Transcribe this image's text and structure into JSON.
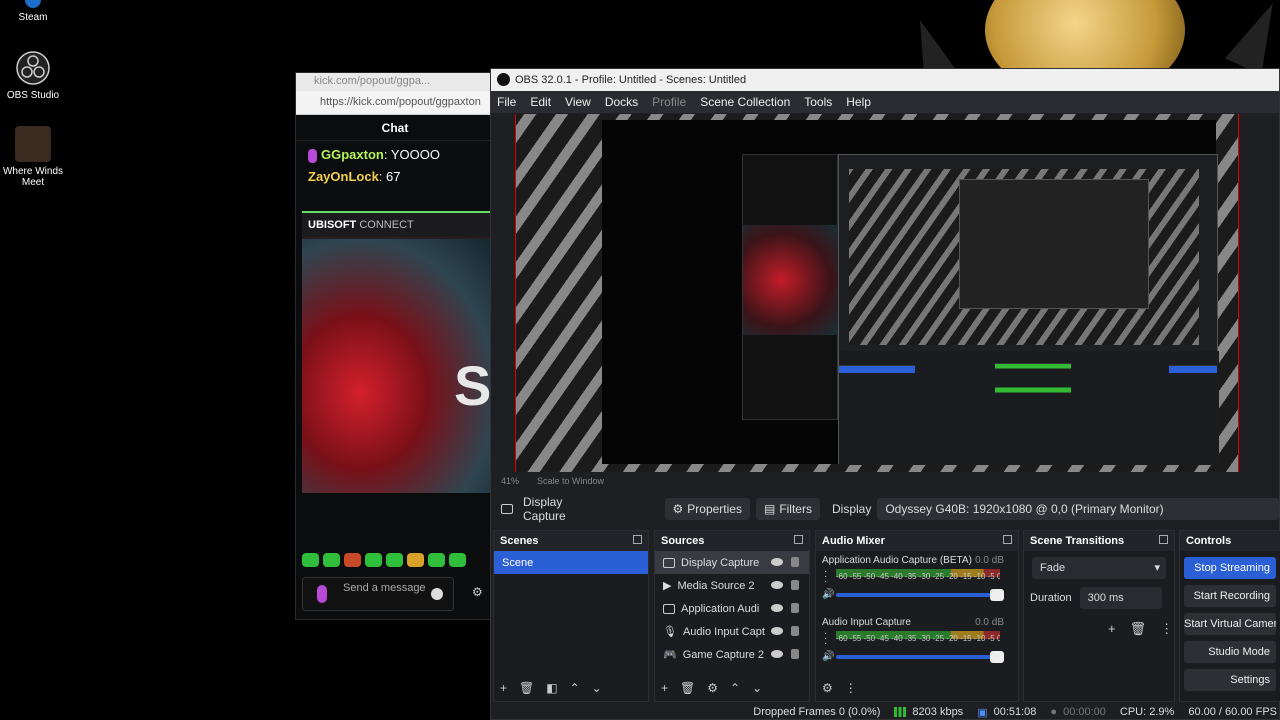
{
  "desktop": {
    "icons": [
      {
        "label": "Steam"
      },
      {
        "label": "OBS Studio"
      },
      {
        "label": "Where Winds Meet"
      }
    ]
  },
  "kick": {
    "title": "kick.com/popout/ggpa...",
    "url": "https://kick.com/popout/ggpaxton",
    "chat_heading": "Chat",
    "messages": [
      {
        "user": "GGpaxton",
        "text": ": YOOOO"
      },
      {
        "user": "ZayOnLock",
        "text": ": 67"
      }
    ],
    "embed_brand": "UBISOFT",
    "embed_brand2": "CONNECT",
    "embed_letter": "S",
    "input_placeholder": "Send a message"
  },
  "obs": {
    "title": "OBS 32.0.1 - Profile: Untitled - Scenes: Untitled",
    "menu": [
      "File",
      "Edit",
      "View",
      "Docks",
      "Profile",
      "Scene Collection",
      "Tools",
      "Help"
    ],
    "zoom": "41%",
    "scale_mode": "Scale to Window",
    "source_bar": {
      "source": "Display Capture",
      "properties": "Properties",
      "filters": "Filters",
      "display_label": "Display",
      "display_value": "Odyssey G40B: 1920x1080 @ 0,0 (Primary Monitor)"
    },
    "scenes": {
      "title": "Scenes",
      "items": [
        "Scene"
      ]
    },
    "sources": {
      "title": "Sources",
      "items": [
        "Display Capture",
        "Media Source 2",
        "Application Audi",
        "Audio Input Capt",
        "Game Capture 2"
      ]
    },
    "mixer": {
      "title": "Audio Mixer",
      "channels": [
        {
          "name": "Application Audio Capture (BETA)",
          "db": "0.0 dB"
        },
        {
          "name": "Audio Input Capture",
          "db": "0.0 dB"
        }
      ],
      "ticks": "-60 -55 -50 -45 -40 -35 -30 -25 -20 -15 -10 -5 0"
    },
    "transitions": {
      "title": "Scene Transitions",
      "type": "Fade",
      "duration_label": "Duration",
      "duration": "300 ms"
    },
    "controls": {
      "title": "Controls",
      "buttons": [
        "Stop Streaming",
        "Start Recording",
        "Start Virtual Camera",
        "Studio Mode",
        "Settings"
      ]
    },
    "status": {
      "dropped": "Dropped Frames 0 (0.0%)",
      "bitrate": "8203 kbps",
      "stream_time": "00:51:08",
      "rec_time": "00:00:00",
      "cpu": "CPU: 2.9%",
      "fps": "60.00 / 60.00 FPS"
    }
  }
}
